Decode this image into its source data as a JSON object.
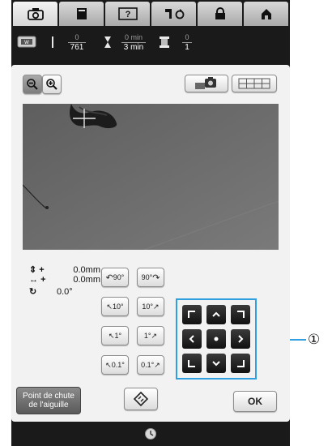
{
  "tabs": [
    {
      "name": "camera",
      "active": true
    },
    {
      "name": "page"
    },
    {
      "name": "help"
    },
    {
      "name": "settings"
    },
    {
      "name": "lock"
    },
    {
      "name": "home"
    }
  ],
  "status": {
    "stitches_done": "0",
    "stitches_total": "761",
    "time_done": "0 min",
    "time_total": "3 min",
    "colors_done": "0",
    "colors_total": "1"
  },
  "readouts": {
    "vertical": {
      "sign": "+",
      "value": "0.0mm"
    },
    "horizontal": {
      "sign": "+",
      "value": "0.0mm"
    },
    "rotation": {
      "value": "0.0°"
    }
  },
  "rotate_buttons": {
    "ccw90": "90°",
    "cw90": "90°",
    "ccw10": "10°",
    "cw10": "10°",
    "ccw1": "1°",
    "cw1": "1°",
    "ccw01": "0.1°",
    "cw01": "0.1°"
  },
  "needle_drop": {
    "line1": "Point de chute",
    "line2": "de l'aiguille"
  },
  "ok_label": "OK",
  "callout": "①"
}
